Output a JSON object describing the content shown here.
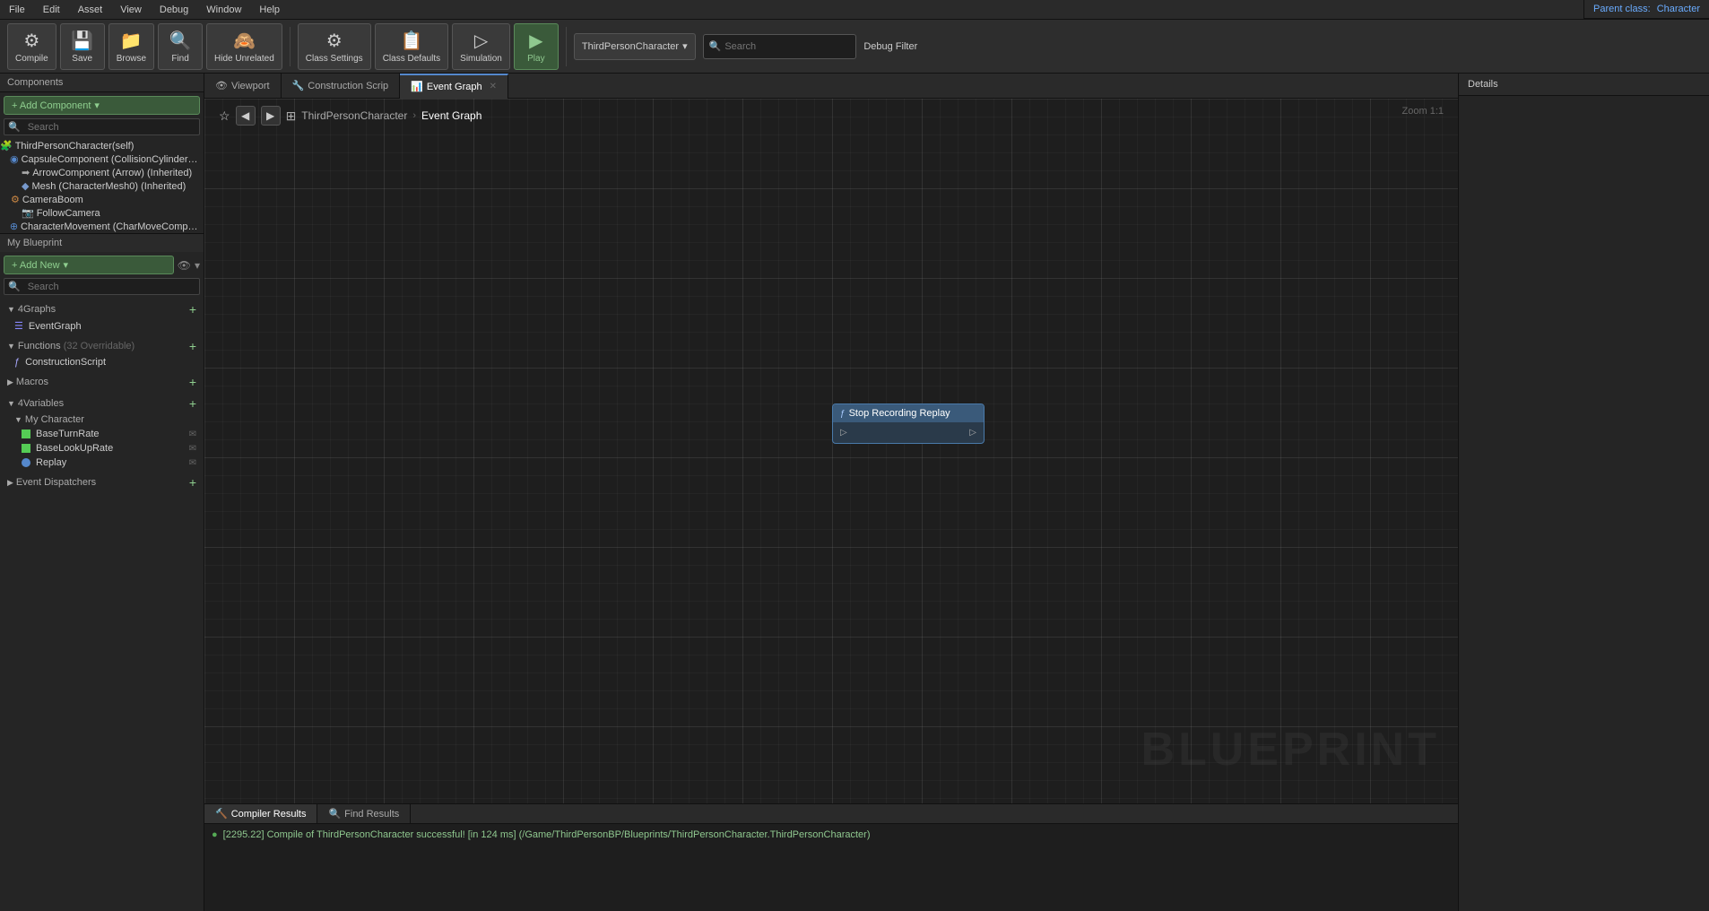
{
  "menuBar": {
    "items": [
      "File",
      "Edit",
      "Asset",
      "View",
      "Debug",
      "Window",
      "Help"
    ]
  },
  "toolbar": {
    "compile_label": "Compile",
    "save_label": "Save",
    "browse_label": "Browse",
    "find_label": "Find",
    "hide_unrelated_label": "Hide Unrelated",
    "class_settings_label": "Class Settings",
    "class_defaults_label": "Class Defaults",
    "simulation_label": "Simulation",
    "play_label": "Play",
    "debug_character_dropdown": "ThirdPersonCharacter",
    "debug_filter_label": "Debug Filter",
    "search_placeholder": "Search"
  },
  "leftPanel": {
    "components_title": "Components",
    "add_component_label": "+ Add Component",
    "search_placeholder": "Search",
    "tree": [
      {
        "label": "ThirdPersonCharacter(self)",
        "indent": 0,
        "icon": "🧩"
      },
      {
        "label": "CapsuleComponent (CollisionCylinder) (Inhe",
        "indent": 1,
        "icon": "🔵"
      },
      {
        "label": "ArrowComponent (Arrow) (Inherited)",
        "indent": 2,
        "icon": "➡"
      },
      {
        "label": "Mesh (CharacterMesh0) (Inherited)",
        "indent": 2,
        "icon": "🔷"
      },
      {
        "label": "CameraBoom",
        "indent": 1,
        "icon": "📷"
      },
      {
        "label": "FollowCamera",
        "indent": 2,
        "icon": "🎥"
      },
      {
        "label": "CharacterMovement (CharMoveComp) (Inher",
        "indent": 1,
        "icon": "🏃"
      }
    ],
    "myBlueprint_title": "My Blueprint",
    "add_new_label": "+ Add New",
    "bp_search_placeholder": "Search",
    "graphs_title": "4Graphs",
    "graphs_items": [
      "EventGraph"
    ],
    "functions_title": "Functions",
    "functions_count": "(32 Overridable)",
    "functions_items": [
      "ConstructionScript"
    ],
    "macros_title": "Macros",
    "variables_title": "4Variables",
    "variables_groups": [
      {
        "group": "My Character",
        "items": [
          {
            "label": "BaseTurnRate",
            "color": "#55cc55",
            "shape": "rect"
          },
          {
            "label": "BaseLookUpRate",
            "color": "#55cc55",
            "shape": "rect"
          },
          {
            "label": "Replay",
            "color": "#5588cc",
            "shape": "circle"
          }
        ]
      }
    ],
    "event_dispatchers_title": "Event Dispatchers"
  },
  "tabs": [
    {
      "label": "Viewport",
      "icon": "👁",
      "active": false
    },
    {
      "label": "Construction Scrip",
      "icon": "🔧",
      "active": false
    },
    {
      "label": "Event Graph",
      "icon": "📊",
      "active": true
    }
  ],
  "canvas": {
    "breadcrumb": {
      "back_tooltip": "Back",
      "forward_tooltip": "Forward",
      "root": "ThirdPersonCharacter",
      "current": "Event Graph"
    },
    "zoom_label": "Zoom 1:1",
    "watermark": "BLUEPRINT",
    "node": {
      "label": "Stop Recording Replay",
      "left_pin": "",
      "right_pin": ""
    }
  },
  "bottomPanel": {
    "tabs": [
      {
        "label": "Compiler Results",
        "icon": "🔨",
        "active": true
      },
      {
        "label": "Find Results",
        "icon": "🔍",
        "active": false
      }
    ],
    "log": "[2295.22] Compile of ThirdPersonCharacter successful! [in 124 ms] (/Game/ThirdPersonBP/Blueprints/ThirdPersonCharacter.ThirdPersonCharacter)"
  },
  "detailsPanel": {
    "title": "Details",
    "parent_class_label": "Parent class:",
    "parent_class_value": "Character"
  }
}
